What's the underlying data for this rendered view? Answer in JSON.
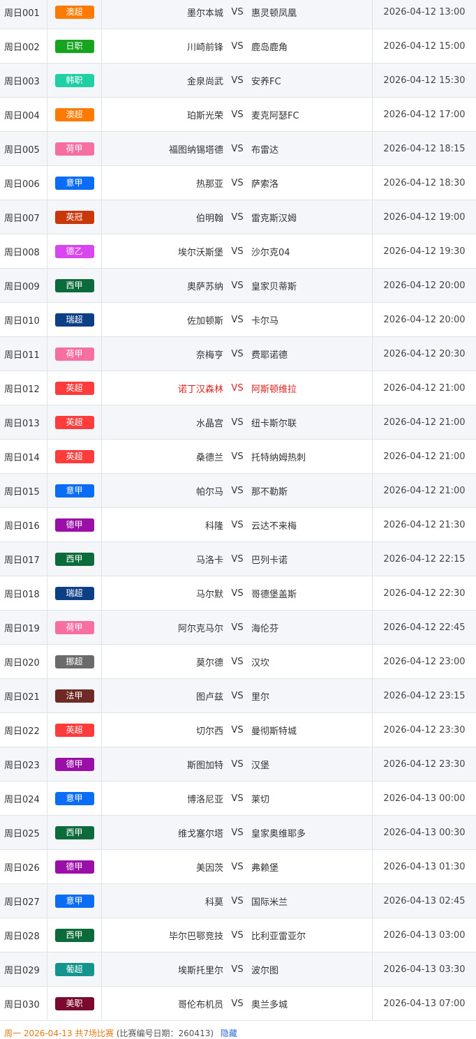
{
  "rows": [
    {
      "no": "周日001",
      "league": "澳超",
      "color": "#ff7a00",
      "home": "墨尔本城",
      "vs": "VS",
      "away": "惠灵顿凤凰",
      "time": "2026-04-12 13:00"
    },
    {
      "no": "周日002",
      "league": "日职",
      "color": "#16a31e",
      "home": "川崎前锋",
      "vs": "VS",
      "away": "鹿岛鹿角",
      "time": "2026-04-12 15:00"
    },
    {
      "no": "周日003",
      "league": "韩职",
      "color": "#21cfa4",
      "home": "金泉尚武",
      "vs": "VS",
      "away": "安养FC",
      "time": "2026-04-12 15:30"
    },
    {
      "no": "周日004",
      "league": "澳超",
      "color": "#ff7a00",
      "home": "珀斯光荣",
      "vs": "VS",
      "away": "麦克阿瑟FC",
      "time": "2026-04-12 17:00"
    },
    {
      "no": "周日005",
      "league": "荷甲",
      "color": "#f76ea0",
      "home": "福图纳锡塔德",
      "vs": "VS",
      "away": "布雷达",
      "time": "2026-04-12 18:15"
    },
    {
      "no": "周日006",
      "league": "意甲",
      "color": "#0b6df5",
      "home": "热那亚",
      "vs": "VS",
      "away": "萨索洛",
      "time": "2026-04-12 18:30"
    },
    {
      "no": "周日007",
      "league": "英冠",
      "color": "#c9380a",
      "home": "伯明翰",
      "vs": "VS",
      "away": "雷克斯汉姆",
      "time": "2026-04-12 19:00"
    },
    {
      "no": "周日008",
      "league": "德乙",
      "color": "#d946ef",
      "home": "埃尔沃斯堡",
      "vs": "VS",
      "away": "沙尔克04",
      "time": "2026-04-12 19:30"
    },
    {
      "no": "周日009",
      "league": "西甲",
      "color": "#0c6b3a",
      "home": "奥萨苏纳",
      "vs": "VS",
      "away": "皇家贝蒂斯",
      "time": "2026-04-12 20:00"
    },
    {
      "no": "周日010",
      "league": "瑞超",
      "color": "#0d3f86",
      "home": "佐加顿斯",
      "vs": "VS",
      "away": "卡尔马",
      "time": "2026-04-12 20:00"
    },
    {
      "no": "周日011",
      "league": "荷甲",
      "color": "#f76ea0",
      "home": "奈梅亨",
      "vs": "VS",
      "away": "费耶诺德",
      "time": "2026-04-12 20:30"
    },
    {
      "no": "周日012",
      "league": "英超",
      "color": "#ff3b3b",
      "home": "诺丁汉森林",
      "vs": "VS",
      "away": "阿斯顿维拉",
      "time": "2026-04-12 21:00",
      "highlight": true
    },
    {
      "no": "周日013",
      "league": "英超",
      "color": "#ff3b3b",
      "home": "水晶宫",
      "vs": "VS",
      "away": "纽卡斯尔联",
      "time": "2026-04-12 21:00"
    },
    {
      "no": "周日014",
      "league": "英超",
      "color": "#ff3b3b",
      "home": "桑德兰",
      "vs": "VS",
      "away": "托特纳姆热刺",
      "time": "2026-04-12 21:00"
    },
    {
      "no": "周日015",
      "league": "意甲",
      "color": "#0b6df5",
      "home": "帕尔马",
      "vs": "VS",
      "away": "那不勒斯",
      "time": "2026-04-12 21:00"
    },
    {
      "no": "周日016",
      "league": "德甲",
      "color": "#9a0fa8",
      "home": "科隆",
      "vs": "VS",
      "away": "云达不来梅",
      "time": "2026-04-12 21:30"
    },
    {
      "no": "周日017",
      "league": "西甲",
      "color": "#0c6b3a",
      "home": "马洛卡",
      "vs": "VS",
      "away": "巴列卡诺",
      "time": "2026-04-12 22:15"
    },
    {
      "no": "周日018",
      "league": "瑞超",
      "color": "#0d3f86",
      "home": "马尔默",
      "vs": "VS",
      "away": "哥德堡盖斯",
      "time": "2026-04-12 22:30"
    },
    {
      "no": "周日019",
      "league": "荷甲",
      "color": "#f76ea0",
      "home": "阿尔克马尔",
      "vs": "VS",
      "away": "海伦芬",
      "time": "2026-04-12 22:45"
    },
    {
      "no": "周日020",
      "league": "挪超",
      "color": "#6b6b6b",
      "home": "莫尔德",
      "vs": "VS",
      "away": "汉坎",
      "time": "2026-04-12 23:00"
    },
    {
      "no": "周日021",
      "league": "法甲",
      "color": "#6e2a24",
      "home": "图卢兹",
      "vs": "VS",
      "away": "里尔",
      "time": "2026-04-12 23:15"
    },
    {
      "no": "周日022",
      "league": "英超",
      "color": "#ff3b3b",
      "home": "切尔西",
      "vs": "VS",
      "away": "曼彻斯特城",
      "time": "2026-04-12 23:30"
    },
    {
      "no": "周日023",
      "league": "德甲",
      "color": "#9a0fa8",
      "home": "斯图加特",
      "vs": "VS",
      "away": "汉堡",
      "time": "2026-04-12 23:30"
    },
    {
      "no": "周日024",
      "league": "意甲",
      "color": "#0b6df5",
      "home": "博洛尼亚",
      "vs": "VS",
      "away": "莱切",
      "time": "2026-04-13 00:00"
    },
    {
      "no": "周日025",
      "league": "西甲",
      "color": "#0c6b3a",
      "home": "维戈塞尔塔",
      "vs": "VS",
      "away": "皇家奥维耶多",
      "time": "2026-04-13 00:30"
    },
    {
      "no": "周日026",
      "league": "德甲",
      "color": "#9a0fa8",
      "home": "美因茨",
      "vs": "VS",
      "away": "弗赖堡",
      "time": "2026-04-13 01:30"
    },
    {
      "no": "周日027",
      "league": "意甲",
      "color": "#0b6df5",
      "home": "科莫",
      "vs": "VS",
      "away": "国际米兰",
      "time": "2026-04-13 02:45"
    },
    {
      "no": "周日028",
      "league": "西甲",
      "color": "#0c6b3a",
      "home": "毕尔巴鄂竞技",
      "vs": "VS",
      "away": "比利亚雷亚尔",
      "time": "2026-04-13 03:00"
    },
    {
      "no": "周日029",
      "league": "葡超",
      "color": "#13948d",
      "home": "埃斯托里尔",
      "vs": "VS",
      "away": "波尔图",
      "time": "2026-04-13 03:30"
    },
    {
      "no": "周日030",
      "league": "美职",
      "color": "#7a0a2e",
      "home": "哥伦布机员",
      "vs": "VS",
      "away": "奥兰多城",
      "time": "2026-04-13 07:00"
    }
  ],
  "footer": {
    "day_link": "周一 2026-04-13 共7场比赛",
    "note": "(比赛编号日期：260413)",
    "hide": "隐藏"
  },
  "colors": {
    "highlight_text": "#e02020",
    "row_alt_bg": "#f4f6f9",
    "border": "#dde4ea"
  }
}
